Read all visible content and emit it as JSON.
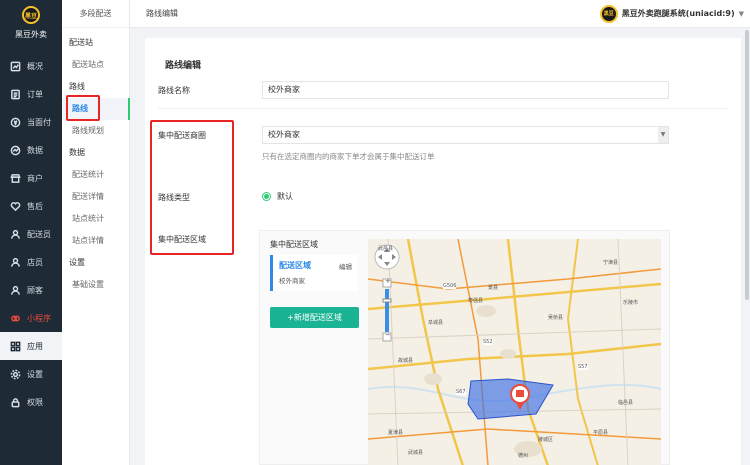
{
  "brand": {
    "logo_text": "黑豆",
    "name": "黑豆外卖"
  },
  "nav": [
    {
      "label": "概况",
      "icon": "gauge-icon"
    },
    {
      "label": "订单",
      "icon": "order-icon"
    },
    {
      "label": "当面付",
      "icon": "pay-icon"
    },
    {
      "label": "数据",
      "icon": "chart-icon"
    },
    {
      "label": "商户",
      "icon": "store-icon"
    },
    {
      "label": "售后",
      "icon": "heart-icon"
    },
    {
      "label": "配送员",
      "icon": "courier-icon"
    },
    {
      "label": "店员",
      "icon": "staff-icon"
    },
    {
      "label": "顾客",
      "icon": "customer-icon"
    },
    {
      "label": "小程序",
      "icon": "miniapp-icon"
    },
    {
      "label": "应用",
      "icon": "apps-icon"
    },
    {
      "label": "设置",
      "icon": "gear-icon"
    },
    {
      "label": "权限",
      "icon": "lock-icon"
    }
  ],
  "subnav": {
    "title": "多段配送",
    "groups": [
      {
        "label": "配送站",
        "items": [
          "配送站点"
        ]
      },
      {
        "label": "路线",
        "items": [
          "路线",
          "路线规划"
        ]
      },
      {
        "label": "数据",
        "items": [
          "配送统计",
          "配送详情",
          "站点统计",
          "站点详情"
        ]
      },
      {
        "label": "设置",
        "items": [
          "基础设置"
        ]
      }
    ]
  },
  "topbar": {
    "breadcrumb": "路线编辑",
    "account_logo": "黑豆",
    "account_name": "黑豆外卖跑腿系统(uniacid:9)",
    "caret": "▼"
  },
  "form": {
    "title": "路线编辑",
    "route_name_label": "路线名称",
    "route_name_value": "校外商家",
    "zone_label": "集中配送商圈",
    "zone_value": "校外商家",
    "zone_hint": "只有在选定商圈内的商家下单才会属于集中配送订单",
    "route_type_label": "路线类型",
    "route_type_option": "默认",
    "area_label": "集中配送区域"
  },
  "area_editor": {
    "title": "集中配送区域",
    "card_name": "配送区域",
    "card_edit": "编辑",
    "card_sub": "校外商家",
    "add_button": "+新增配送区域"
  },
  "map": {
    "zoom_in": "+",
    "zoom_out": "−",
    "labels": [
      "G506",
      "S52",
      "S57",
      "S67",
      "武邑县",
      "枣强县",
      "宁津县",
      "故城县",
      "景县",
      "阜城县",
      "吴桥县",
      "武城县",
      "夏津县",
      "平原县",
      "陵城区",
      "德州",
      "临邑县",
      "乐陵市"
    ]
  },
  "colors": {
    "sidebar_bg": "#1f2a37",
    "accent_green": "#1ab394",
    "link_blue": "#2e8ae6",
    "highlight_red": "#e82525",
    "mini_red": "#e84c3d"
  }
}
